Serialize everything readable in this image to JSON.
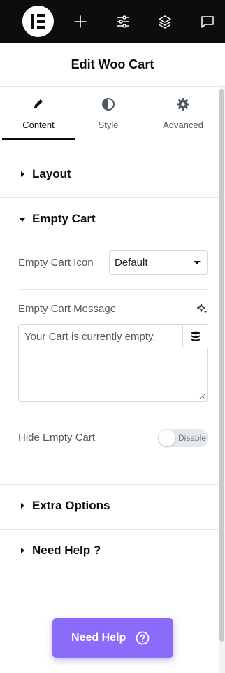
{
  "topbar": {
    "logo_icon": "elementor-logo-icon",
    "items": [
      {
        "name": "plus-icon"
      },
      {
        "name": "sliders-icon"
      },
      {
        "name": "layers-icon"
      },
      {
        "name": "comment-icon"
      }
    ]
  },
  "header": {
    "title": "Edit Woo Cart"
  },
  "tabs": [
    {
      "label": "Content",
      "icon": "pencil-icon",
      "active": true
    },
    {
      "label": "Style",
      "icon": "half-circle-icon",
      "active": false
    },
    {
      "label": "Advanced",
      "icon": "gear-icon",
      "active": false
    }
  ],
  "sections": {
    "layout": {
      "title": "Layout",
      "expanded": false
    },
    "empty_cart": {
      "title": "Empty Cart",
      "expanded": true,
      "icon_field": {
        "label": "Empty Cart Icon",
        "value": "Default"
      },
      "message_field": {
        "label": "Empty Cart Message",
        "value": "Your Cart is currently empty.",
        "ai_icon": "sparkle-icon",
        "dynamic_icon": "database-icon"
      },
      "hide_field": {
        "label": "Hide Empty Cart",
        "toggle_label": "Disable",
        "on": false
      }
    },
    "extra_options": {
      "title": "Extra Options",
      "expanded": false
    },
    "need_help": {
      "title": "Need Help ?",
      "expanded": false
    }
  },
  "help_button": {
    "label": "Need Help",
    "icon": "question-circle-icon"
  },
  "colors": {
    "topbar_bg": "#0c0d0e",
    "accent": "#8a6bfa",
    "text_primary": "#0c0d0e",
    "text_secondary": "#515962",
    "border": "#d5d8dc"
  }
}
